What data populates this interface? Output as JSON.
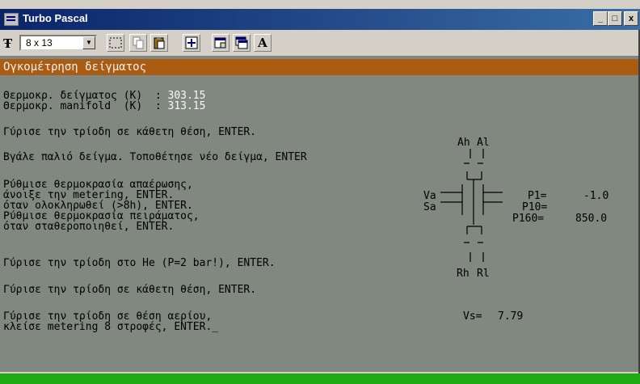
{
  "window": {
    "title": "Turbo Pascal"
  },
  "titlebar_buttons": {
    "minimize": "_",
    "maximize": "□",
    "close": "x"
  },
  "toolbar": {
    "font_size": "8 x 13",
    "font_button": "A"
  },
  "console": {
    "header": "Ογκομέτρηση δείγματος",
    "temp_sample_label": "Θερμοκρ. δείγματος (K)  : ",
    "temp_sample_value": "303.15",
    "temp_manifold_label": "Θερμοκρ. manifold  (K)  : ",
    "temp_manifold_value": "313.15",
    "instructions": [
      "Γύρισε την τρίοδη σε κάθετη θέση, ENTER.",
      "Βγάλε παλιό δείγμα. Τοποθέτησε νέο δείγμα, ENTER",
      "Ρύθμισε θερμοκρασία απαέρωσης,",
      "άνοιξε την metering, ENTER.",
      "όταν ολοκληρωθεί (>8h), ENTER.",
      "Ρύθμισε θερμοκρασία πειράματος,",
      "όταν σταθεροποιηθεί, ENTER.",
      "Γύρισε την τρίοδη στο He (P=2 bar!), ENTER.",
      "Γύρισε την τρίοδη σε κάθετη θέση, ENTER.",
      "Γύρισε την τρίοδη σε θέση αερίου,",
      "κλείσε metering 8 στροφές, ENTER._"
    ]
  },
  "diagram": {
    "ah": "Ah",
    "al": "Al",
    "va": "Va",
    "sa": "Sa",
    "rh": "Rh",
    "rl": "Rl",
    "p1_label": "P1=",
    "p1_value": "-1.0",
    "p10_label": "P10=",
    "p160_label": "P160=",
    "p160_value": "850.0",
    "vs_label": "Vs=",
    "vs_value": "7.79"
  },
  "colors": {
    "console_bg": "#808880",
    "header_bg": "#aa5c12",
    "value_white": "#f8f8f8",
    "value_yellow": "#f6f65a",
    "value_red": "#a8000a",
    "status_green": "#1eaa12"
  },
  "icons": [
    "app-icon",
    "font-tt-icon",
    "mark-icon",
    "copy-icon",
    "paste-icon",
    "fullscreen-icon",
    "properties-icon",
    "background-icon",
    "font-a-icon"
  ]
}
